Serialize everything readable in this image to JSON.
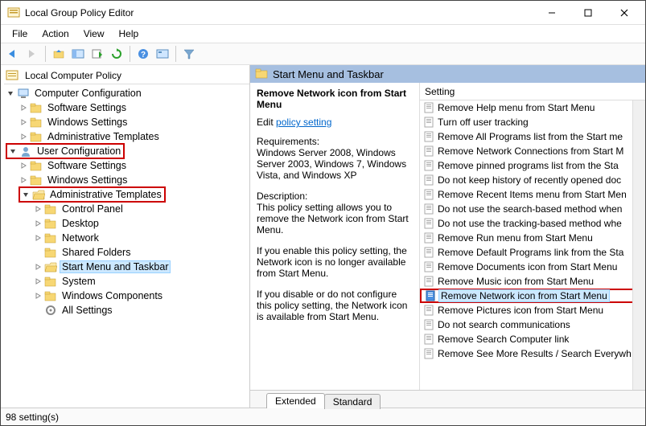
{
  "window": {
    "title": "Local Group Policy Editor"
  },
  "menu": {
    "file": "File",
    "action": "Action",
    "view": "View",
    "help": "Help"
  },
  "left_header": "Local Computer Policy",
  "tree": [
    {
      "indent": 0,
      "icon": "computer",
      "twisty": "down",
      "label": "Computer Configuration"
    },
    {
      "indent": 1,
      "icon": "folder",
      "twisty": "right",
      "label": "Software Settings"
    },
    {
      "indent": 1,
      "icon": "folder",
      "twisty": "right",
      "label": "Windows Settings"
    },
    {
      "indent": 1,
      "icon": "folder",
      "twisty": "right",
      "label": "Administrative Templates"
    },
    {
      "indent": 0,
      "icon": "user",
      "twisty": "down",
      "label": "User Configuration",
      "redbox": true
    },
    {
      "indent": 1,
      "icon": "folder",
      "twisty": "right",
      "label": "Software Settings"
    },
    {
      "indent": 1,
      "icon": "folder",
      "twisty": "right",
      "label": "Windows Settings"
    },
    {
      "indent": 1,
      "icon": "folder-open",
      "twisty": "down",
      "label": "Administrative Templates",
      "redbox": true
    },
    {
      "indent": 2,
      "icon": "folder",
      "twisty": "right",
      "label": "Control Panel"
    },
    {
      "indent": 2,
      "icon": "folder",
      "twisty": "right",
      "label": "Desktop"
    },
    {
      "indent": 2,
      "icon": "folder",
      "twisty": "right",
      "label": "Network"
    },
    {
      "indent": 2,
      "icon": "folder",
      "twisty": "none",
      "label": "Shared Folders"
    },
    {
      "indent": 2,
      "icon": "folder-open",
      "twisty": "right",
      "label": "Start Menu and Taskbar",
      "selected": true
    },
    {
      "indent": 2,
      "icon": "folder",
      "twisty": "right",
      "label": "System"
    },
    {
      "indent": 2,
      "icon": "folder",
      "twisty": "right",
      "label": "Windows Components"
    },
    {
      "indent": 2,
      "icon": "settings",
      "twisty": "none",
      "label": "All Settings"
    }
  ],
  "right_header": "Start Menu and Taskbar",
  "desc": {
    "title": "Remove Network icon from Start Menu",
    "edit_prefix": "Edit ",
    "policy_link": "policy setting",
    "req_label": "Requirements:",
    "req_text": "Windows Server 2008, Windows Server 2003, Windows 7, Windows Vista, and Windows XP",
    "desc_label": "Description:",
    "desc_text": "This policy setting allows you to remove the Network icon from Start Menu.",
    "p3": "If you enable this policy setting, the Network icon is no longer available from Start Menu.",
    "p4": "If you disable or do not configure this policy setting, the Network icon is available from Start Menu."
  },
  "list_header": "Setting",
  "settings": [
    {
      "label": "Remove Help menu from Start Menu"
    },
    {
      "label": "Turn off user tracking"
    },
    {
      "label": "Remove All Programs list from the Start me"
    },
    {
      "label": "Remove Network Connections from Start M"
    },
    {
      "label": "Remove pinned programs list from the Sta"
    },
    {
      "label": "Do not keep history of recently opened doc"
    },
    {
      "label": "Remove Recent Items menu from Start Men"
    },
    {
      "label": "Do not use the search-based method when"
    },
    {
      "label": "Do not use the tracking-based method whe"
    },
    {
      "label": "Remove Run menu from Start Menu"
    },
    {
      "label": "Remove Default Programs link from the Sta"
    },
    {
      "label": "Remove Documents icon from Start Menu"
    },
    {
      "label": "Remove Music icon from Start Menu"
    },
    {
      "label": "Remove Network icon from Start Menu",
      "selected": true,
      "redbox": true
    },
    {
      "label": "Remove Pictures icon from Start Menu"
    },
    {
      "label": "Do not search communications"
    },
    {
      "label": "Remove Search Computer link"
    },
    {
      "label": "Remove See More Results / Search Everywh"
    }
  ],
  "tabs": {
    "extended": "Extended",
    "standard": "Standard"
  },
  "status": "98 setting(s)"
}
